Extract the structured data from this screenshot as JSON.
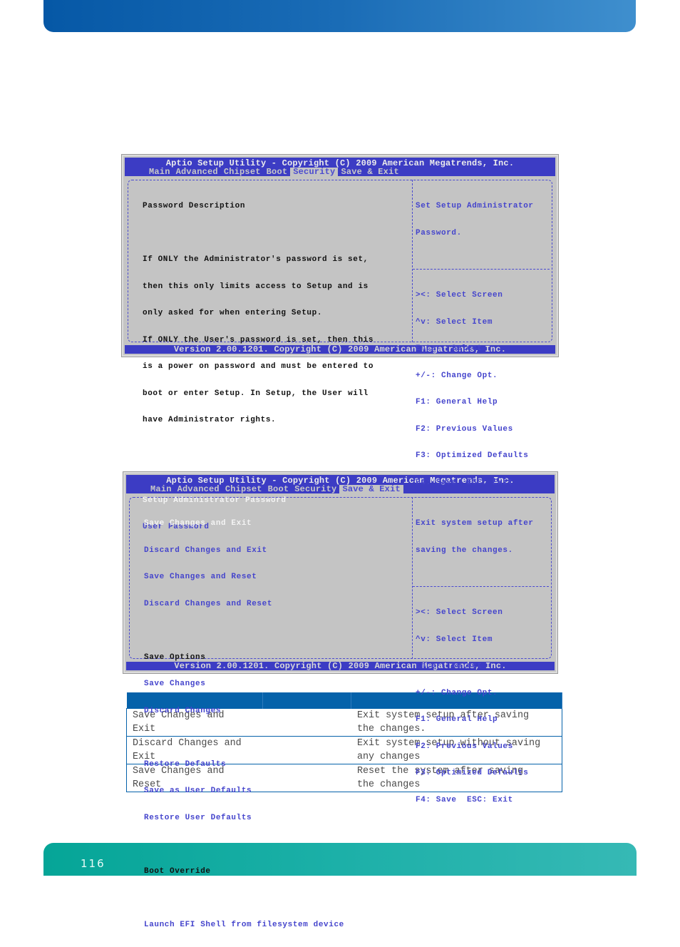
{
  "page_number": "116",
  "bios_common": {
    "title": "Aptio Setup Utility - Copyright (C) 2009 American Megatrends, Inc.",
    "tabs": [
      "Main",
      "Advanced",
      "Chipset",
      "Boot",
      "Security",
      "Save & Exit"
    ],
    "footer": "Version 2.00.1201. Copyright (C) 2009 American Megatrends, Inc.",
    "help_keys": [
      "><: Select Screen",
      "^v: Select Item",
      "Enter: Select",
      "+/-: Change Opt.",
      "F1: General Help",
      "F2: Previous Values",
      "F3: Optimized Defaults",
      "F4: Save  ESC: Exit"
    ],
    "colors": {
      "bar": "#3c3cc4",
      "body": "#c4c4c4",
      "item": "#4444cc",
      "selected": "#f4f4f4"
    }
  },
  "screen_security": {
    "active_tab": "Security",
    "heading": "Password Description",
    "description": [
      "If ONLY the Administrator's password is set,",
      "then this only limits access to Setup and is",
      "only asked for when entering Setup.",
      "If ONLY the User's password is set, then this",
      "is a power on password and must be entered to",
      "boot or enter Setup. In Setup, the User will",
      "have Administrator rights."
    ],
    "items": [
      "Setup Administrator Password",
      "User Password"
    ],
    "selected_item": "Setup Administrator Password",
    "help_text": [
      "Set Setup Administrator",
      "Password."
    ]
  },
  "screen_save_exit": {
    "active_tab": "Save & Exit",
    "items_top": [
      "Save Changes and Exit",
      "Discard Changes and Exit",
      "Save Changes and Reset",
      "Discard Changes and Reset"
    ],
    "selected_item": "Save Changes and Exit",
    "save_options_heading": "Save Options",
    "save_options": [
      "Save Changes",
      "Discard Changes"
    ],
    "defaults": [
      "Restore Defaults",
      "Save as User Defaults",
      "Restore User Defaults"
    ],
    "boot_override_heading": "Boot Override",
    "boot_override": [
      "Launch EFI Shell from filesystem device"
    ],
    "help_text": [
      "Exit system setup after",
      "saving the changes."
    ]
  },
  "table": {
    "header_color": "#0562aa",
    "headers": [
      "",
      "",
      ""
    ],
    "rows": [
      {
        "option": [
          "Save Changes and",
          "Exit"
        ],
        "value": "",
        "description": [
          "Exit system setup after saving",
          "the changes."
        ]
      },
      {
        "option": [
          "Discard Changes and",
          "Exit"
        ],
        "value": "",
        "description": [
          "Exit system setup without saving",
          "any changes"
        ]
      },
      {
        "option": [
          "Save Changes and",
          "Reset"
        ],
        "value": "",
        "description": [
          "Reset the system after saving",
          "the changes"
        ]
      }
    ]
  }
}
